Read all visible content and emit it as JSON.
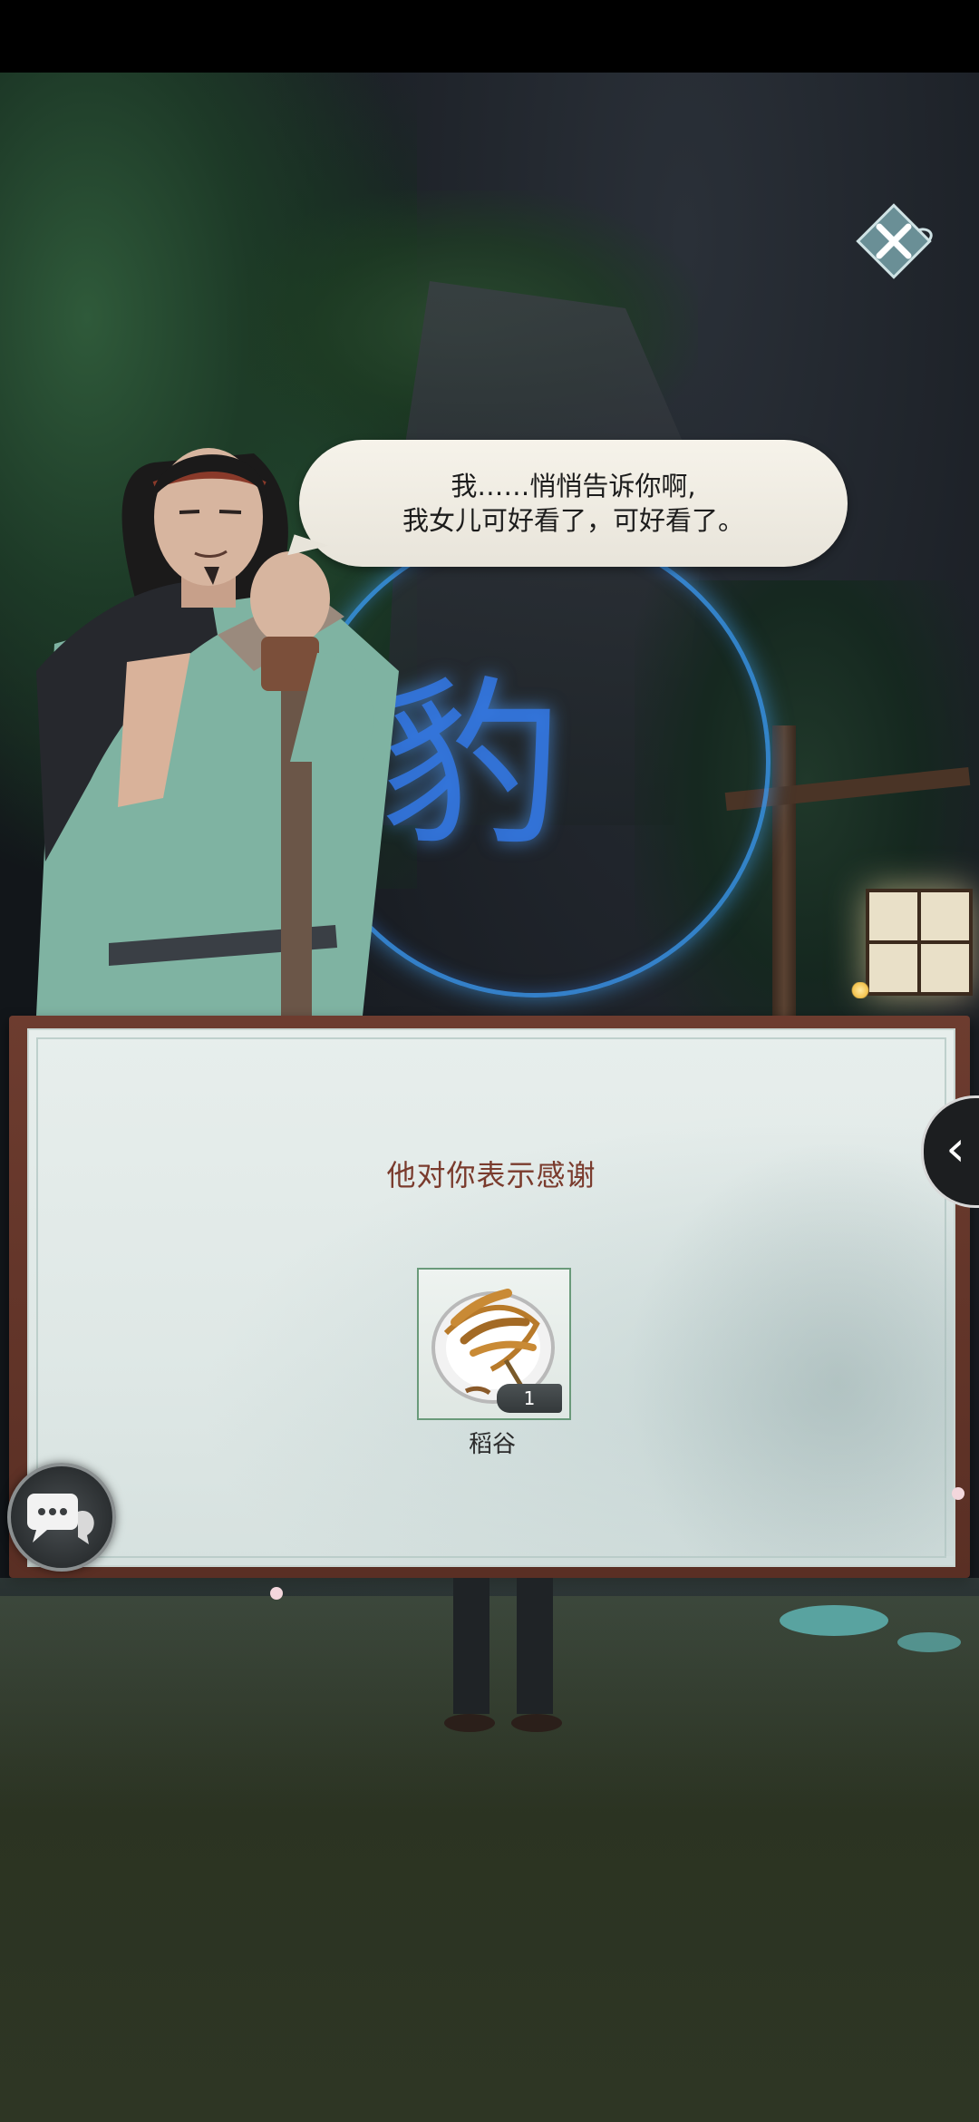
{
  "dialogue": {
    "line1": "我……悄悄告诉你啊,",
    "line2": "我女儿可好看了，可好看了。"
  },
  "reward_panel": {
    "title": "他对你表示感谢",
    "item": {
      "name": "稻谷",
      "count": "1",
      "icon": "rice-grain-icon"
    }
  },
  "background": {
    "glyph": "豹",
    "ring_color": "#3ca0ff"
  },
  "controls": {
    "close_icon": "close-x-icon",
    "chat_icon": "chat-bubble-icon",
    "side_arrow": "‹"
  },
  "colors": {
    "panel_frame": "#6d3c2f",
    "panel_bg": "#e4ecea",
    "title_text": "#7a3b2d",
    "slot_border": "#6a9a7a"
  }
}
